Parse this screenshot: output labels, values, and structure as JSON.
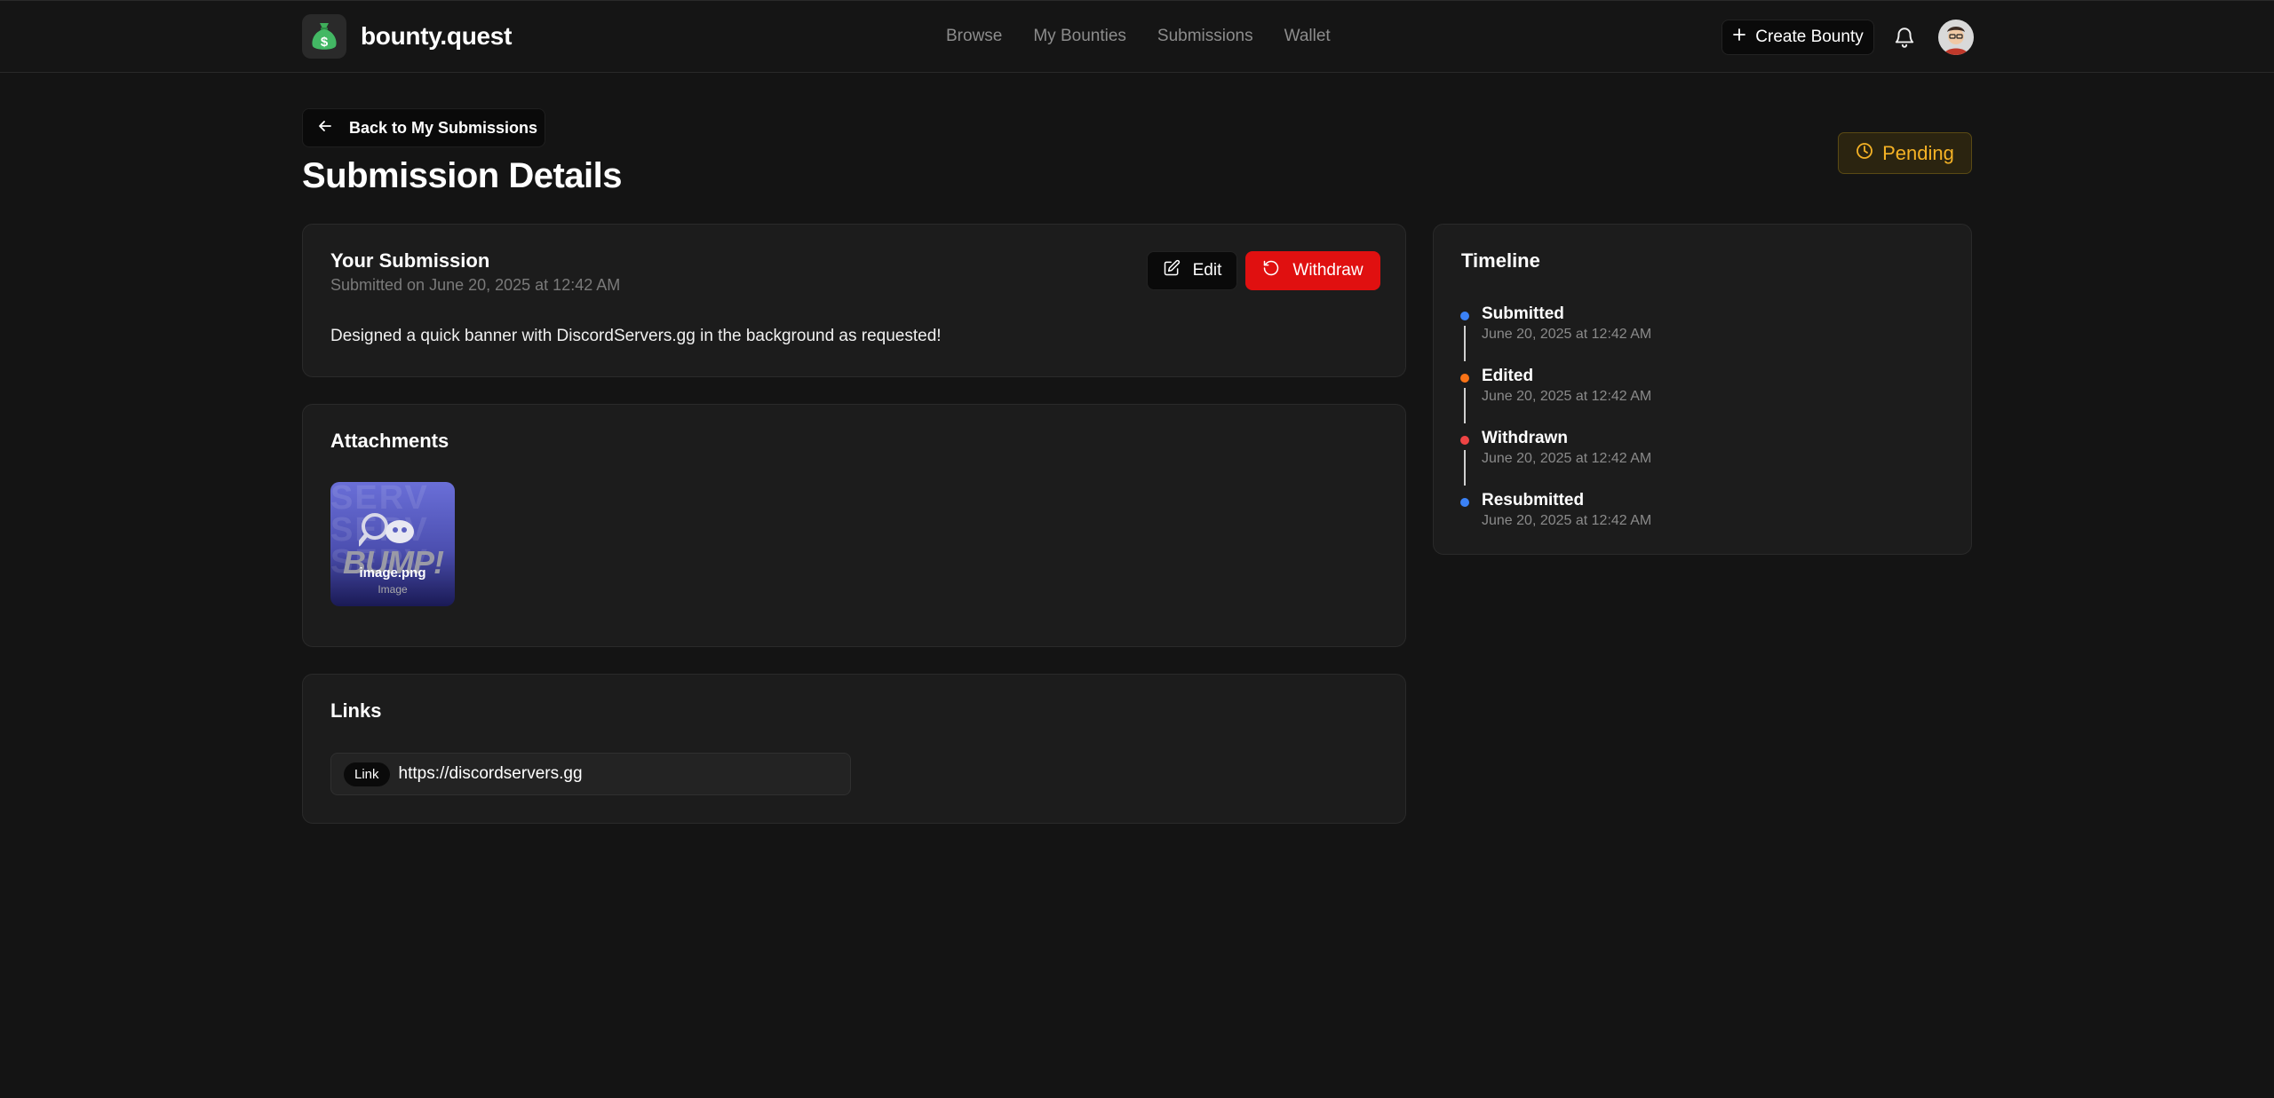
{
  "header": {
    "brand": "bounty.quest",
    "nav": [
      "Browse",
      "My Bounties",
      "Submissions",
      "Wallet"
    ],
    "create_label": "Create Bounty"
  },
  "back_label": "Back to My Submissions",
  "page_title": "Submission Details",
  "status": {
    "label": "Pending",
    "color": "#f5b225"
  },
  "submission": {
    "title": "Your Submission",
    "date": "Submitted on June 20, 2025 at 12:42 AM",
    "edit_label": "Edit",
    "withdraw_label": "Withdraw",
    "description": "Designed a quick banner with DiscordServers.gg in the background as requested!"
  },
  "attachments": {
    "title": "Attachments",
    "items": [
      {
        "name": "image.png",
        "type": "Image",
        "image_text": "BUMP!"
      }
    ]
  },
  "links": {
    "title": "Links",
    "items": [
      {
        "tag": "Link",
        "url": "https://discordservers.gg"
      }
    ]
  },
  "timeline": {
    "title": "Timeline",
    "events": [
      {
        "label": "Submitted",
        "date": "June 20, 2025 at 12:42 AM",
        "color": "#3b82f6"
      },
      {
        "label": "Edited",
        "date": "June 20, 2025 at 12:42 AM",
        "color": "#f97316"
      },
      {
        "label": "Withdrawn",
        "date": "June 20, 2025 at 12:42 AM",
        "color": "#ef4444"
      },
      {
        "label": "Resubmitted",
        "date": "June 20, 2025 at 12:42 AM",
        "color": "#3b82f6"
      }
    ]
  }
}
